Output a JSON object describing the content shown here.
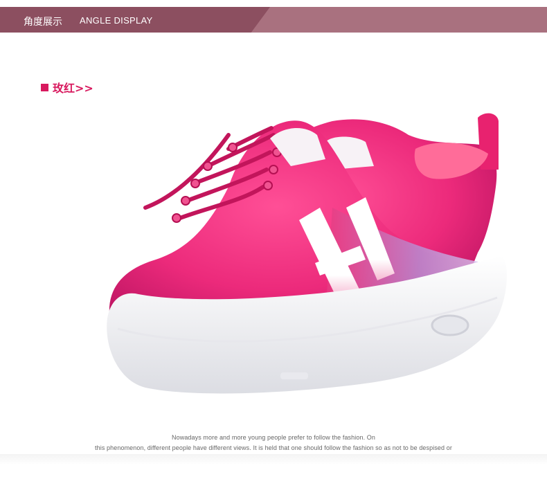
{
  "header": {
    "title_cn": "角度展示",
    "title_en": "ANGLE DISPLAY",
    "colors": {
      "dark": "#8c4f60",
      "light": "#a9717f"
    }
  },
  "color_option": {
    "label": "玫红>>",
    "accent": "#d8195e"
  },
  "product": {
    "description": "pair of rose-pink knit sneakers with white H stripes and air-cushion soles",
    "colors": {
      "upper": "#f0317f",
      "sole": "#f5f5f7",
      "accent_stripe": "#ffffff",
      "side_knit": "#b98dd8"
    }
  },
  "caption": {
    "line1": "Nowadays more and more young people prefer to follow the fashion.  On",
    "line2": "this phenomenon, different people have different views. It is held that one should follow the fashion so as not to be despised or"
  }
}
